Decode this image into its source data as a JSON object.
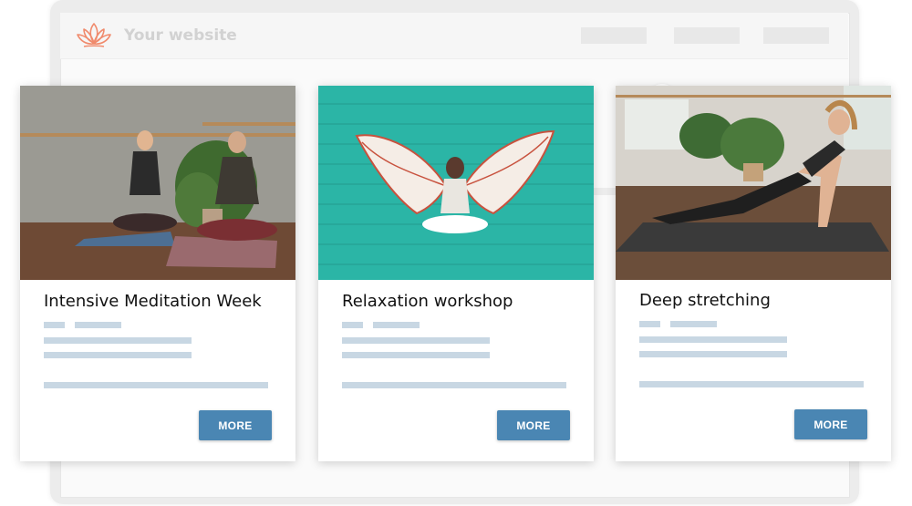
{
  "site": {
    "title": "Your website",
    "logo_icon": "lotus-icon",
    "nav_placeholders": 3
  },
  "cards": [
    {
      "title": "Intensive Meditation Week",
      "button_label": "MORE",
      "image": "couple-meditating-photo"
    },
    {
      "title": "Relaxation workshop",
      "button_label": "MORE",
      "image": "woman-with-painted-wings-photo"
    },
    {
      "title": "Deep stretching",
      "button_label": "MORE",
      "image": "woman-stretching-yoga-photo"
    }
  ],
  "colors": {
    "button": "#4a86b3",
    "placeholder_line": "#c8d7e3",
    "logo": "#f08a6c",
    "teal_wall": "#2bb5a6"
  }
}
